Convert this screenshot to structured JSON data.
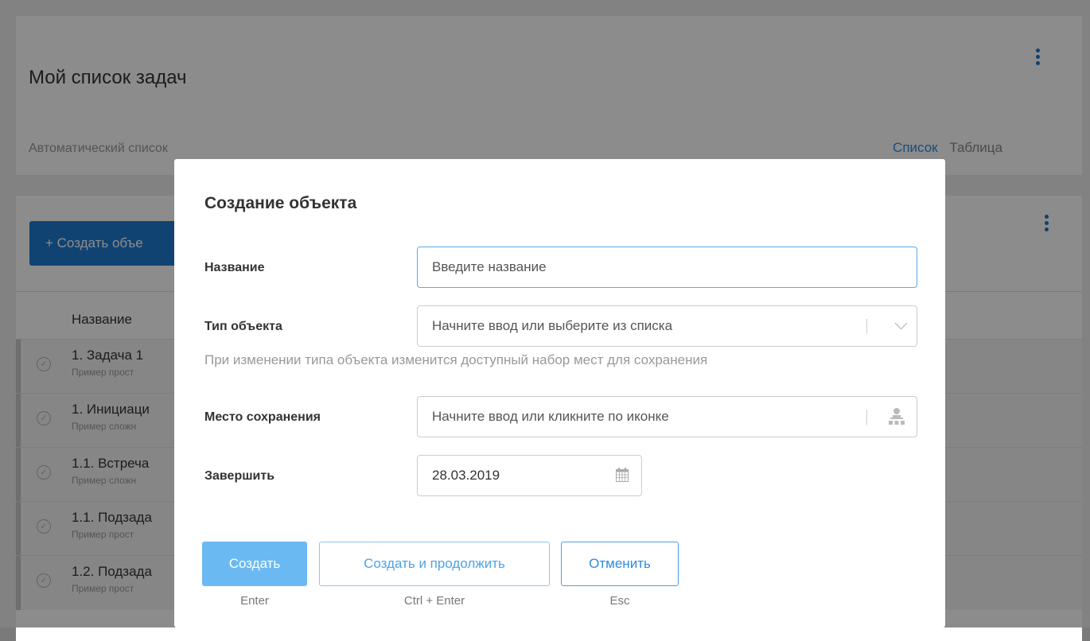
{
  "page": {
    "title": "Мой список задач",
    "list_mode": "Автоматический список",
    "views": [
      "Список",
      "Таблица"
    ],
    "active_view": "Список",
    "create_button": "+ Создать объе",
    "column_header": "Название",
    "rows": [
      {
        "title": "1. Задача 1",
        "subtitle": "Пример прост"
      },
      {
        "title": "1. Инициаци",
        "subtitle": "Пример сложн"
      },
      {
        "title": "1.1. Встреча",
        "subtitle": "Пример сложн"
      },
      {
        "title": "1.1. Подзада",
        "subtitle": "Пример прост"
      },
      {
        "title": "1.2. Подзада",
        "subtitle": "Пример прост"
      }
    ]
  },
  "modal": {
    "title": "Создание объекта",
    "fields": {
      "name": {
        "label": "Название",
        "placeholder": "Введите название",
        "value": ""
      },
      "type": {
        "label": "Тип объекта",
        "placeholder": "Начните ввод или выберите из списка"
      },
      "type_hint": "При изменении типа объекта изменится доступный набор мест для сохранения",
      "place": {
        "label": "Место сохранения",
        "placeholder": "Начните ввод или кликните по иконке"
      },
      "finish": {
        "label": "Завершить",
        "value": "28.03.2019"
      }
    },
    "buttons": {
      "create": {
        "label": "Создать",
        "shortcut": "Enter"
      },
      "create_continue": {
        "label": "Создать и продолжить",
        "shortcut": "Ctrl + Enter"
      },
      "cancel": {
        "label": "Отменить",
        "shortcut": "Esc"
      }
    }
  },
  "icons": {
    "more": "kebab-icon",
    "row_check": "check-circle-icon",
    "dropdown": "chevron-down-icon",
    "tree": "tree-structure-icon",
    "calendar": "calendar-icon"
  },
  "colors": {
    "accent": "#1f7bd0",
    "primary_button": "#6bb9f2",
    "link": "#2b8be0"
  }
}
